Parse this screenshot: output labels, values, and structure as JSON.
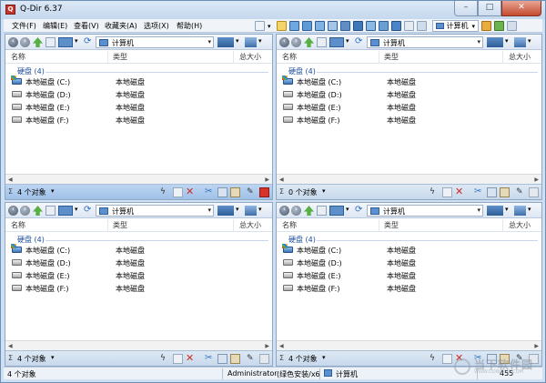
{
  "window": {
    "title": "Q-Dir 6.37",
    "icon": "app-icon-q",
    "buttons": [
      "minimize",
      "maximize",
      "close"
    ]
  },
  "menu": [
    "文件(F)",
    "编辑(E)",
    "查看(V)",
    "收藏夹(A)",
    "选项(X)",
    "帮助(H)"
  ],
  "toolbar_right": {
    "location_label": "计算机"
  },
  "pane_template": {
    "address": "计算机",
    "columns": [
      "名称",
      "类型",
      "总大小"
    ],
    "group": "硬盘 (4)",
    "drives": [
      {
        "name": "本地磁盘 (C:)",
        "type": "本地磁盘",
        "system": true
      },
      {
        "name": "本地磁盘 (D:)",
        "type": "本地磁盘",
        "system": false
      },
      {
        "name": "本地磁盘 (E:)",
        "type": "本地磁盘",
        "system": false
      },
      {
        "name": "本地磁盘 (F:)",
        "type": "本地磁盘",
        "system": false
      }
    ]
  },
  "panes": [
    {
      "id": "top-left",
      "status_count": "4 个对象",
      "active": true
    },
    {
      "id": "top-right",
      "status_count": "0 个对象",
      "active": false
    },
    {
      "id": "bottom-left",
      "status_count": "4 个对象",
      "active": false
    },
    {
      "id": "bottom-right",
      "status_count": "4 个对象",
      "active": false
    }
  ],
  "status_bar": {
    "objects": "4 个对象",
    "user": "Administrator",
    "edition": "(绿色安装/x6",
    "location": "计算机",
    "number": "455"
  },
  "watermark": {
    "text": "当下软件园",
    "sub": "WWW.DOWNXIA.COM"
  },
  "colors": {
    "accent": "#3c7fd0",
    "chrome": "#cfe0f2",
    "close": "#c34a2f",
    "group": "#1f4fa0"
  }
}
